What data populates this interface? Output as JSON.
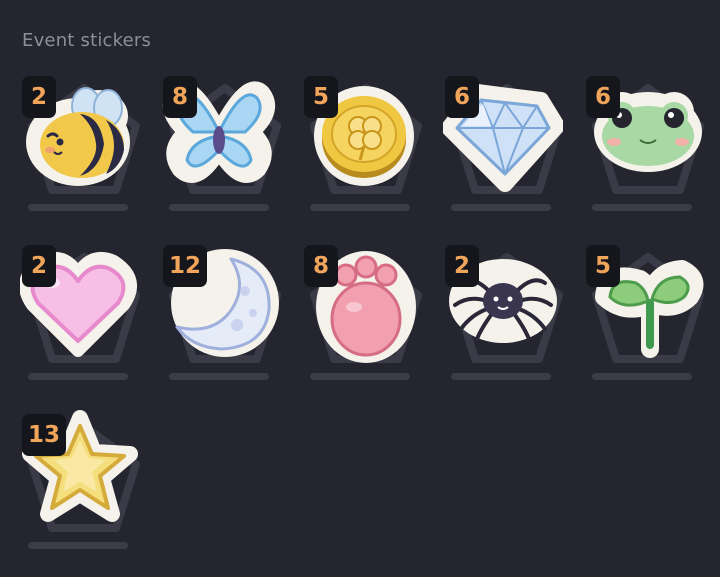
{
  "title": "Event stickers",
  "stickers": [
    {
      "name": "bee",
      "count": "2"
    },
    {
      "name": "butterfly",
      "count": "8"
    },
    {
      "name": "coin",
      "count": "5"
    },
    {
      "name": "diamond",
      "count": "6"
    },
    {
      "name": "frog",
      "count": "6"
    },
    {
      "name": "heart",
      "count": "2"
    },
    {
      "name": "moon",
      "count": "12"
    },
    {
      "name": "paw",
      "count": "8"
    },
    {
      "name": "spider",
      "count": "2"
    },
    {
      "name": "sprout",
      "count": "5"
    },
    {
      "name": "star",
      "count": "13"
    }
  ]
}
